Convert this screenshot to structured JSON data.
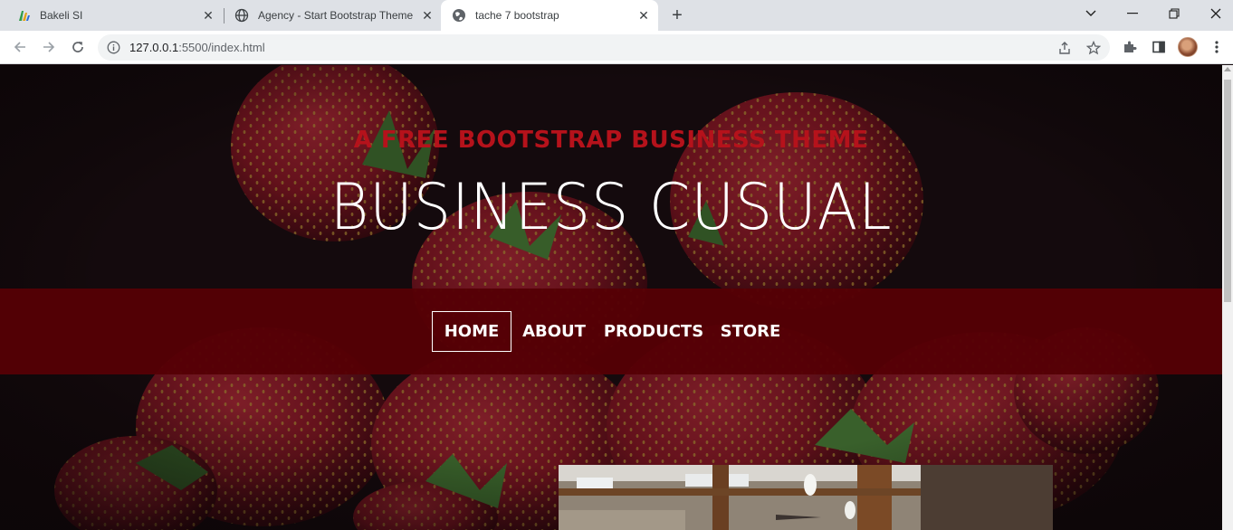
{
  "browser": {
    "tabs": [
      {
        "title": "Bakeli SI",
        "icon": "bakeli-logo-icon",
        "active": false
      },
      {
        "title": "Agency - Start Bootstrap Theme",
        "icon": "globe-icon",
        "active": false
      },
      {
        "title": "tache 7 bootstrap",
        "icon": "globe-icon",
        "active": true
      }
    ],
    "url": "127.0.0.1:5500/index.html",
    "url_host": "127.0.0.1",
    "url_rest": ":5500/index.html"
  },
  "page": {
    "subtitle": "A FREE BOOTSTRAP BUSINESS THEME",
    "title": "BUSINESS CUSUAL",
    "nav": [
      {
        "label": "HOME",
        "active": true
      },
      {
        "label": "ABOUT",
        "active": false
      },
      {
        "label": "PRODUCTS",
        "active": false
      },
      {
        "label": "STORE",
        "active": false
      }
    ]
  },
  "colors": {
    "subtitle_red": "#b5121b",
    "nav_bg": "#550005",
    "page_bg": "#140b0f"
  }
}
